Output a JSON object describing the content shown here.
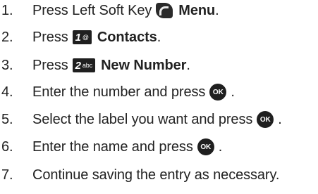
{
  "steps": [
    {
      "num": "1.",
      "text": "Press Left Soft Key",
      "key_label": "Menu",
      "tail": "."
    },
    {
      "num": "2.",
      "text": "Press",
      "key_face": "1",
      "key_sub": "@",
      "key_label": "Contacts",
      "tail": "."
    },
    {
      "num": "3.",
      "text": "Press",
      "key_face": "2",
      "key_sub": "abc",
      "key_label": "New Number",
      "tail": "."
    },
    {
      "num": "4.",
      "text": "Enter the number and press",
      "ok_label": "OK",
      "tail": "."
    },
    {
      "num": "5.",
      "text": "Select the label you want and press",
      "ok_label": "OK",
      "tail": "."
    },
    {
      "num": "6.",
      "text": "Enter the name and press",
      "ok_label": "OK",
      "tail": "."
    },
    {
      "num": "7.",
      "text": "Continue saving the entry as necessary."
    }
  ],
  "icons": {
    "softkey": "left-soft-key-icon",
    "ok": "ok-key-icon",
    "key1": "key-1-icon",
    "key2": "key-2-icon"
  }
}
